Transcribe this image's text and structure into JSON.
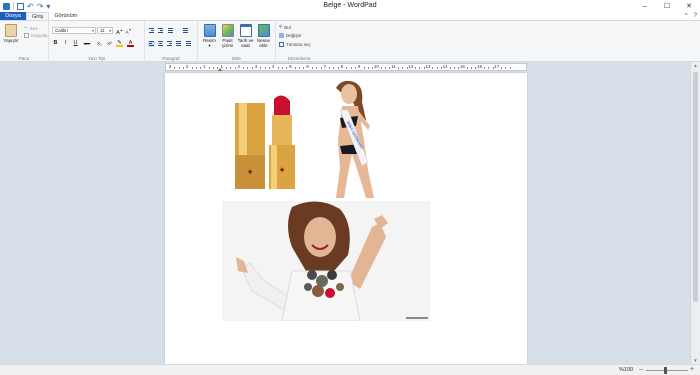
{
  "window": {
    "title": "Belge - WordPad",
    "controls": {
      "minimize": "–",
      "maximize": "☐",
      "close": "✕"
    }
  },
  "quick_access": {
    "undo": "↶",
    "redo": "↷",
    "customize": "▾"
  },
  "tabs": {
    "file": "Dosya",
    "home": "Giriş",
    "view": "Görünüm",
    "collapse": "^",
    "help": "?"
  },
  "ribbon": {
    "clipboard": {
      "label": "Pano",
      "paste": "Yapıştır",
      "cut": "Kes",
      "copy": "Kopyala"
    },
    "font": {
      "label": "Yazı Tipi",
      "family": "Calibri",
      "size": "11",
      "bold": "B",
      "italic": "I",
      "underline": "U",
      "strike": "abc",
      "subscript": "X₂",
      "superscript": "X²"
    },
    "paragraph": {
      "label": "Paragraf"
    },
    "insert": {
      "label": "Ekle",
      "picture": "Resim",
      "paint": "Paint çizimi",
      "datetime": "Tarih ve saat",
      "object": "Nesne ekle"
    },
    "editing": {
      "label": "Düzenleme",
      "find": "Bul",
      "replace": "Değiştir",
      "select_all": "Tümünü seç"
    }
  },
  "ruler": {
    "labels": [
      "3",
      "2",
      "1",
      "1",
      "2",
      "3",
      "4",
      "5",
      "6",
      "7",
      "8",
      "9",
      "10",
      "11",
      "12",
      "13",
      "14",
      "15",
      "16",
      "17"
    ]
  },
  "status": {
    "zoom": "%100",
    "zoom_minus": "–",
    "zoom_plus": "+",
    "zoom_level": 1.0
  },
  "document": {
    "images": [
      {
        "name": "lipstick",
        "subject": "YSL red lipstick"
      },
      {
        "name": "model-sash",
        "subject": "model with sash",
        "sash_text": "MISS GERMANY"
      },
      {
        "name": "model-pose",
        "subject": "model posing with necklaces"
      }
    ]
  },
  "colors": {
    "file_tab": "#1e5fb8",
    "doc_background": "#d7dfe9",
    "lipstick_red": "#c8102e",
    "gold": "#d9a441"
  }
}
